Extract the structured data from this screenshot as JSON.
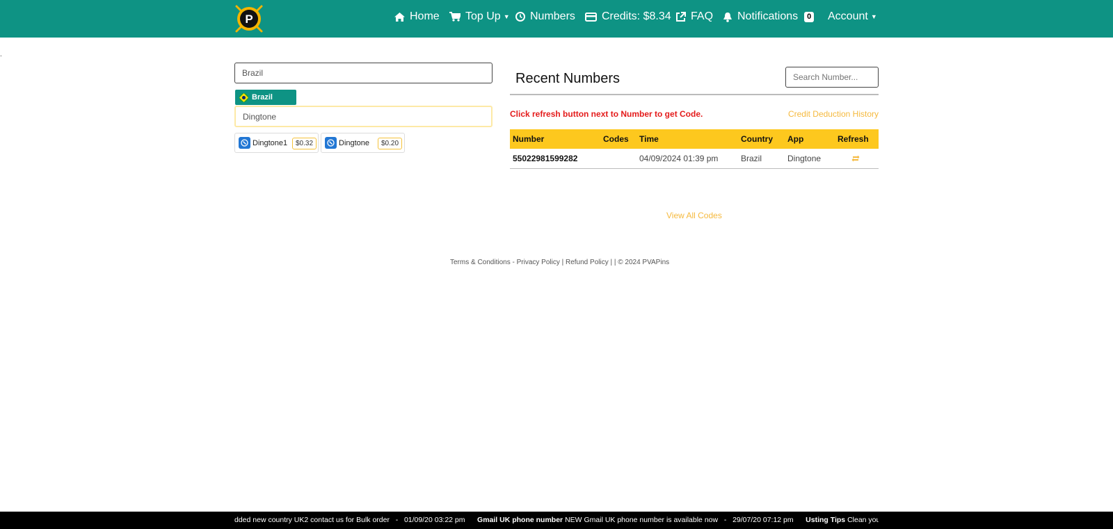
{
  "nav": {
    "brand_letter": "P",
    "items": [
      {
        "label": "Home",
        "icon": "home-icon"
      },
      {
        "label": "Top Up",
        "icon": "cart-icon",
        "dropdown": true
      },
      {
        "label": "Numbers",
        "icon": "clock-icon"
      },
      {
        "label": "Credits: $8.34",
        "icon": "credit-card-icon"
      },
      {
        "label": "FAQ",
        "icon": "external-link-icon"
      },
      {
        "label": "Notifications",
        "icon": "bell-icon",
        "badge": "0"
      },
      {
        "label": "Account",
        "dropdown": true
      }
    ]
  },
  "order": {
    "country_value": "Brazil",
    "selected_country": "Brazil",
    "app_value": "Dingtone",
    "apps": [
      {
        "name": "Dingtone1",
        "price": "$0.32"
      },
      {
        "name": "Dingtone",
        "price": "$0.20"
      }
    ]
  },
  "recent": {
    "title": "Recent Numbers",
    "search_placeholder": "Search Number...",
    "note": "Click refresh button next to Number to get Code.",
    "deduction_link": "Credit Deduction History",
    "columns": [
      "Number",
      "Codes",
      "Time",
      "Country",
      "App",
      "Refresh"
    ],
    "rows": [
      {
        "number": "55022981599282",
        "codes": "",
        "time": "04/09/2024 01:39 pm",
        "country": "Brazil",
        "app": "Dingtone"
      }
    ],
    "view_all": "View All Codes"
  },
  "footer": {
    "terms": "Terms & Conditions",
    "sep1": " - ",
    "privacy": "Privacy Policy",
    "sep2": " | ",
    "refund": "Refund Policy",
    "copyright": " | | © 2024 PVAPins"
  },
  "ticker": {
    "item1_text": "dded new country UK2 contact us for Bulk order",
    "item1_date": "01/09/20 03:22 pm",
    "item2_title": "Gmail UK phone number",
    "item2_text": "NEW Gmail UK phone number is available now",
    "item2_date": "29/07/20 07:12 pm",
    "item3_title": "Usting Tips",
    "item3_text": "Clean your browser tc"
  },
  "colors": {
    "navbar": "#0e9384",
    "table_header": "#fdc81e",
    "note_red": "#e41b1b",
    "link_gold": "#f5b93d"
  }
}
